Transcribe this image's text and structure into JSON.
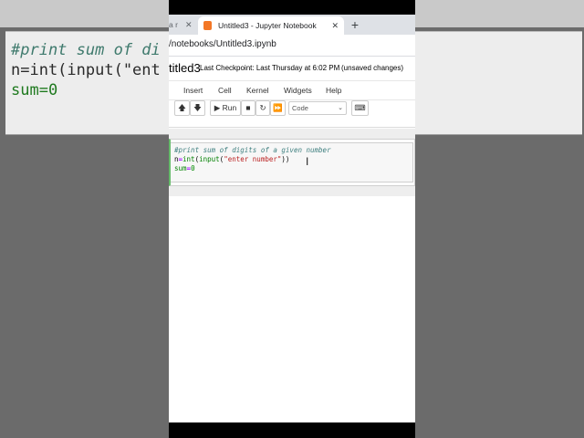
{
  "backdrop": {
    "code_line1": "#print sum of di",
    "code_line2": "n=int(input(\"ent",
    "code_line3": "sum=0"
  },
  "browser": {
    "tabs": [
      {
        "label": "a r",
        "active": false
      },
      {
        "label": "Untitled3 - Jupyter Notebook",
        "active": true
      }
    ],
    "close_glyph": "✕",
    "new_tab_glyph": "+",
    "url": "/notebooks/Untitled3.ipynb"
  },
  "notebook": {
    "name": "titled3",
    "checkpoint": "Last Checkpoint: Last Thursday at 6:02 PM",
    "unsaved": "(unsaved changes)",
    "menu": [
      "Insert",
      "Cell",
      "Kernel",
      "Widgets",
      "Help"
    ],
    "toolbar": {
      "up_glyph": "🡅",
      "down_glyph": "🡇",
      "run_label": "Run",
      "stop_glyph": "■",
      "restart_glyph": "↻",
      "fast_forward_glyph": "⏩",
      "keyboard_glyph": "⌨"
    },
    "cell_type": "Code",
    "cell": {
      "line1": "#print sum of digits of a given number",
      "line2_a": "n",
      "line2_b": "=",
      "line2_c": "int",
      "line2_d": "(",
      "line2_e": "input",
      "line2_f": "(",
      "line2_g": "\"enter number\"",
      "line2_h": "))",
      "line3_a": "sum",
      "line3_b": "=",
      "line3_c": "0"
    }
  },
  "colors": {
    "jupyter_orange": "#f37726",
    "cell_border_active": "#66bb6a"
  },
  "icons": [
    "close-icon",
    "plus-icon",
    "jupyter-favicon",
    "arrow-up-icon",
    "arrow-down-icon",
    "play-icon",
    "stop-icon",
    "restart-icon",
    "fast-forward-icon",
    "keyboard-icon",
    "text-cursor-icon"
  ]
}
